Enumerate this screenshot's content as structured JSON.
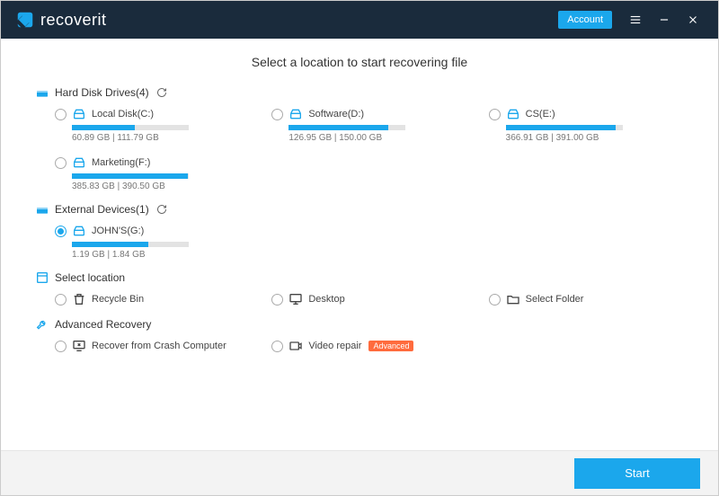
{
  "titlebar": {
    "logo_text": "recoverit",
    "account_label": "Account"
  },
  "page_title": "Select a location to start recovering file",
  "sections": {
    "hdd": {
      "title": "Hard Disk Drives(4)",
      "drives": [
        {
          "label": "Local Disk(C:)",
          "used": 60.89,
          "total": 111.79,
          "text": "60.89  GB | 111.79  GB",
          "percent": 54
        },
        {
          "label": "Software(D:)",
          "used": 126.95,
          "total": 150.0,
          "text": "126.95  GB | 150.00  GB",
          "percent": 85
        },
        {
          "label": "CS(E:)",
          "used": 366.91,
          "total": 391.0,
          "text": "366.91  GB | 391.00  GB",
          "percent": 94
        },
        {
          "label": "Marketing(F:)",
          "used": 385.83,
          "total": 390.5,
          "text": "385.83  GB | 390.50  GB",
          "percent": 99
        }
      ]
    },
    "external": {
      "title": "External Devices(1)",
      "drives": [
        {
          "label": "JOHN'S(G:)",
          "used": 1.19,
          "total": 1.84,
          "text": "1.19  GB | 1.84  GB",
          "percent": 65,
          "selected": true
        }
      ]
    },
    "location": {
      "title": "Select location",
      "items": [
        {
          "label": "Recycle Bin"
        },
        {
          "label": "Desktop"
        },
        {
          "label": "Select Folder"
        }
      ]
    },
    "advanced": {
      "title": "Advanced Recovery",
      "items": [
        {
          "label": "Recover from Crash Computer"
        },
        {
          "label": "Video repair",
          "badge": "Advanced"
        }
      ]
    }
  },
  "footer": {
    "start_label": "Start"
  }
}
